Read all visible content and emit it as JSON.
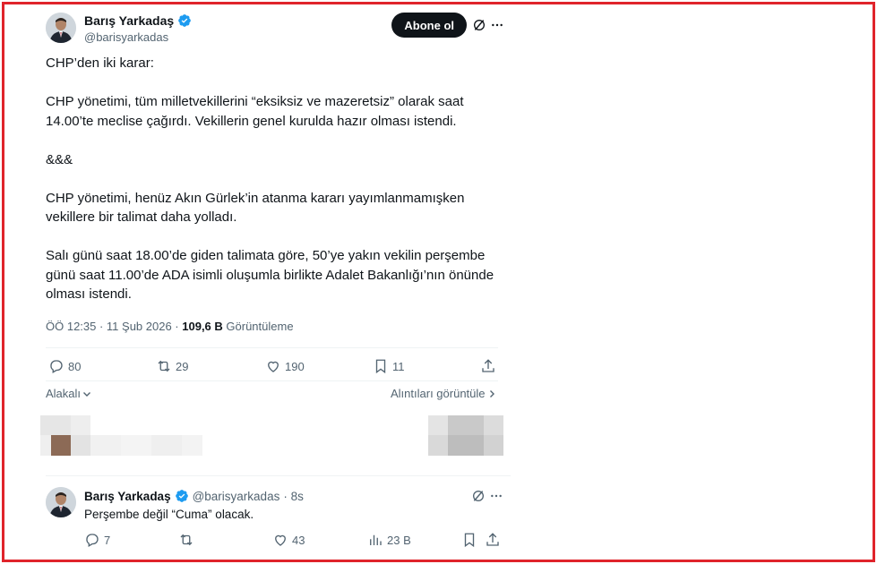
{
  "tweet": {
    "author": {
      "display_name": "Barış Yarkadaş",
      "handle": "@barisyarkadas"
    },
    "subscribe_label": "Abone ol",
    "body": "CHP’den iki karar:\n\nCHP yönetimi, tüm milletvekillerini “eksiksiz ve mazeretsiz” olarak saat 14.00’te meclise çağırdı. Vekillerin genel kurulda hazır olması istendi.\n\n&&&\n\nCHP yönetimi, henüz Akın Gürlek’in atanma kararı yayımlanmamışken vekillere bir talimat daha yolladı.\n\nSalı günü saat 18.00’de giden talimata göre, 50’ye yakın vekilin perşembe günü saat 11.00’de ADA isimli oluşumla  birlikte Adalet Bakanlığı’nın önünde olması istendi.",
    "timestamp": "ÖÖ 12:35 · 11 Şub 2026 · ",
    "views_count": "109,6 B",
    "views_label": " Görüntüleme",
    "actions": {
      "replies": "80",
      "reposts": "29",
      "likes": "190",
      "bookmarks": "11"
    },
    "related_label": "Alakalı",
    "quotes_label": "Alıntıları görüntüle"
  },
  "reply": {
    "author": {
      "display_name": "Barış Yarkadaş",
      "handle": "@barisyarkadas",
      "time": "· 8s"
    },
    "text": "Perşembe değil “Cuma” olacak.",
    "actions": {
      "replies": "7",
      "reposts": "",
      "likes": "43",
      "views": "23 B"
    }
  },
  "colors": {
    "frame": "#e0242b",
    "verified": "#1d9bf0",
    "text": "#0f1419",
    "muted": "#536471"
  }
}
